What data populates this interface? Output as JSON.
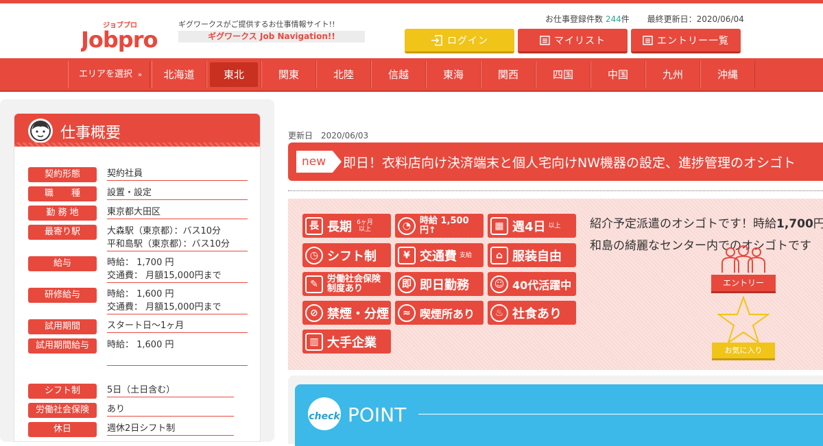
{
  "header": {
    "logo_text": "Jobpro",
    "logo_kana": "ジョブプロ",
    "tagline": "ギグワークスがご提供するお仕事情報サイト!!",
    "tagbar": "ギグワークス Job Navigation!!",
    "count_label": "お仕事登録件数",
    "count_value": "244",
    "count_unit": "件",
    "updated": "最終更新日：2020/06/04",
    "login_label": "ログイン",
    "mylist_label": "マイリスト",
    "entrylist_label": "エントリー一覧"
  },
  "nav": {
    "area_label": "エリアを選択",
    "area_chevron": "»",
    "items": [
      "北海道",
      "東北",
      "関東",
      "北陸",
      "信越",
      "東海",
      "関西",
      "四国",
      "中国",
      "九州",
      "沖縄"
    ],
    "active": "東北"
  },
  "summary": {
    "title": "仕事概要",
    "rows": [
      {
        "label": "契約形態",
        "value": "契約社員"
      },
      {
        "label": "職　　種",
        "value": "設置・設定"
      },
      {
        "label": "勤 務 地",
        "value": "東京都大田区"
      },
      {
        "label": "最寄り駅",
        "value1": "大森駅（東京都）：バス10分",
        "value2": "平和島駅（東京都）：バス10分"
      },
      {
        "label": "給与",
        "value1": "時給： 1,700 円",
        "value2": "交通費： 月額15,000円まで"
      },
      {
        "label": "研修給与",
        "value1": "時給： 1,600 円",
        "value2": "交通費： 月額15,000円まで"
      },
      {
        "label": "試用期間",
        "value": "スタート日～1ヶ月"
      },
      {
        "label": "試用期間給与",
        "value": "時給： 1,600 円"
      },
      {
        "label": "シフト制",
        "value": "5日（土日含む）"
      },
      {
        "label": "労働社会保険",
        "value": "あり"
      },
      {
        "label": "休日",
        "value": "週休2日シフト制"
      }
    ]
  },
  "job": {
    "updated_label": "更新日",
    "updated_date": "2020/06/03",
    "new_tag": "new",
    "title": "即日！衣料店向け決済端末と個人宅向けNW機器の設定、進捗管理のオシゴト"
  },
  "features": {
    "badges": [
      {
        "icon": "長",
        "text": "長期",
        "sub": "6ヶ月以上"
      },
      {
        "icon": "◔",
        "text": "時給 1,500円↑"
      },
      {
        "icon": "▦",
        "text": "週4日",
        "sub": "以上"
      },
      {
        "icon": "◷",
        "text": "シフト制"
      },
      {
        "icon": "¥",
        "text": "交通費",
        "sub": "支給"
      },
      {
        "icon": "⌂",
        "text": "服装自由"
      },
      {
        "icon": "✎",
        "text": "労働社会保険 制度あり"
      },
      {
        "icon": "即",
        "text": "即日勤務"
      },
      {
        "icon": "☺",
        "text": "40代活躍中"
      },
      {
        "icon": "⊘",
        "text": "禁煙・分煙"
      },
      {
        "icon": "≈",
        "text": "喫煙所あり"
      },
      {
        "icon": "♨",
        "text": "社食あり"
      },
      {
        "icon": "▥",
        "text": "大手企業"
      }
    ],
    "intro_line1_a": "紹介予定派遣のオシゴトです！時給",
    "intro_line1_b": "1,700",
    "intro_line1_c": "円",
    "intro_line2": "和島の綺麗なセンター内でのオシゴトです",
    "entry_label": "エントリー",
    "fav_label": "お気に入り"
  },
  "point": {
    "check_label": "check",
    "title": "POINT"
  },
  "colors": {
    "brand_red": "#e8493d",
    "yellow": "#f0c419",
    "point_blue": "#3cb9e8",
    "count_green": "#2aa78f"
  }
}
